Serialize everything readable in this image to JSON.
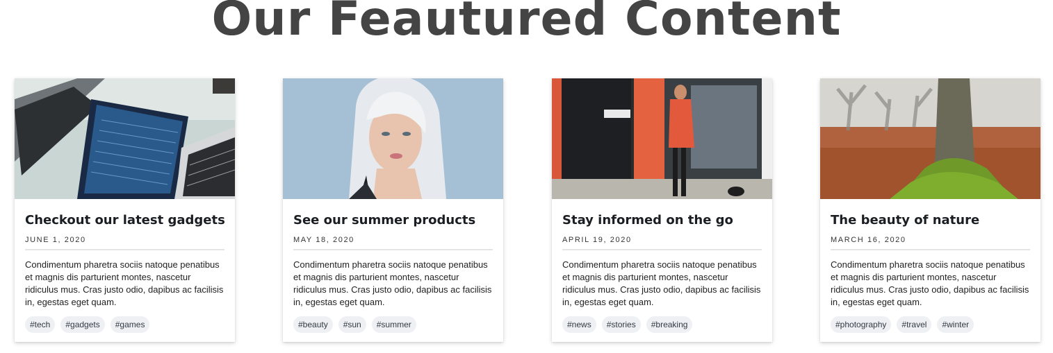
{
  "page": {
    "title": "Our Feautured Content"
  },
  "cards": [
    {
      "image_alt": "laptops",
      "title": "Checkout our latest gadgets",
      "date": "JUNE 1, 2020",
      "text": "Condimentum pharetra sociis natoque penatibus et magnis dis parturient montes, nascetur ridiculus mus. Cras justo odio, dapibus ac facilisis in, egestas eget quam.",
      "tags": [
        "#tech",
        "#gadgets",
        "#games"
      ]
    },
    {
      "image_alt": "portrait",
      "title": "See our summer products",
      "date": "MAY 18, 2020",
      "text": "Condimentum pharetra sociis natoque penatibus et magnis dis parturient montes, nascetur ridiculus mus. Cras justo odio, dapibus ac facilisis in, egestas eget quam.",
      "tags": [
        "#beauty",
        "#sun",
        "#summer"
      ]
    },
    {
      "image_alt": "street",
      "title": "Stay informed on the go",
      "date": "APRIL 19, 2020",
      "text": "Condimentum pharetra sociis natoque penatibus et magnis dis parturient montes, nascetur ridiculus mus. Cras justo odio, dapibus ac facilisis in, egestas eget quam.",
      "tags": [
        "#news",
        "#stories",
        "#breaking"
      ]
    },
    {
      "image_alt": "tree",
      "title": "The beauty of nature",
      "date": "MARCH 16, 2020",
      "text": "Condimentum pharetra sociis natoque penatibus et magnis dis parturient montes, nascetur ridiculus mus. Cras justo odio, dapibus ac facilisis in, egestas eget quam.",
      "tags": [
        "#photography",
        "#travel",
        "#winter"
      ]
    }
  ],
  "colors": {
    "title": "#444444",
    "tag_bg": "#eef0f3",
    "divider": "#e3e5e8"
  }
}
